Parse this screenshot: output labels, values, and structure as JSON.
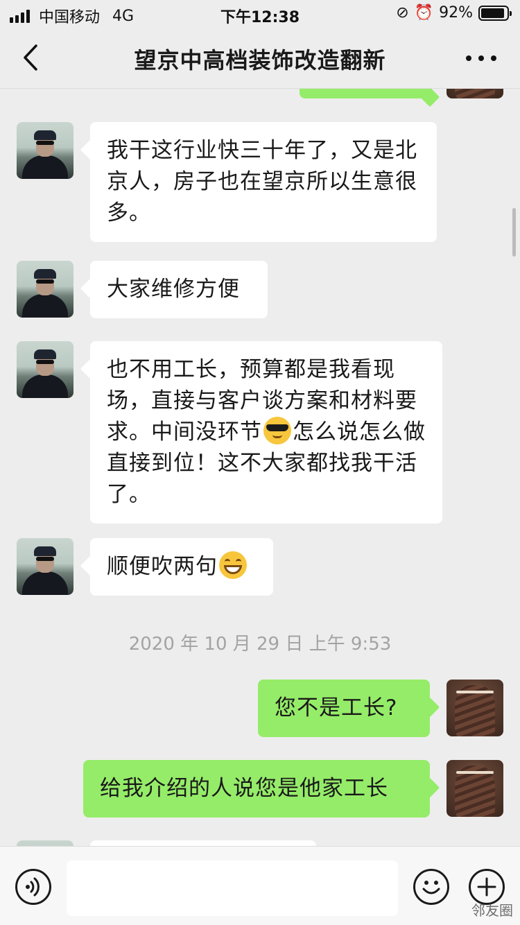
{
  "status_bar": {
    "carrier": "中国移动",
    "network": "4G",
    "time": "下午12:38",
    "battery_percent": "92%",
    "battery_level": 0.92,
    "icons": [
      "signal-icon",
      "orientation-lock-icon",
      "alarm-icon",
      "battery-icon"
    ]
  },
  "nav": {
    "title": "望京中高档装饰改造翻新",
    "back_icon": "chevron-left-icon",
    "more_icon": "more-dots-icon"
  },
  "messages": [
    {
      "side": "left",
      "text": "我干这行业快三十年了，又是北京人，房子也在望京所以生意很多。"
    },
    {
      "side": "left",
      "text": "大家维修方便"
    },
    {
      "side": "left",
      "text_before": "也不用工长，预算都是我看现场，直接与客户谈方案和材料要求。中间没环节",
      "emoji": "cool-face",
      "text_after": "怎么说怎么做直接到位！这不大家都找我干活了。"
    },
    {
      "side": "left",
      "text_before": "顺便吹两句",
      "emoji": "grin-face"
    },
    {
      "side": "right",
      "text": "您不是工长?"
    },
    {
      "side": "right",
      "text": "给我介绍的人说您是他家工长"
    }
  ],
  "timestamp": "2020 年 10 月 29 日 上午 9:53",
  "input_bar": {
    "voice_icon": "voice-icon",
    "emoji_icon": "emoji-icon",
    "plus_icon": "plus-icon"
  },
  "watermark": "邻友圈",
  "colors": {
    "background": "#ededed",
    "bubble_self": "#95ec69",
    "bubble_other": "#ffffff"
  }
}
